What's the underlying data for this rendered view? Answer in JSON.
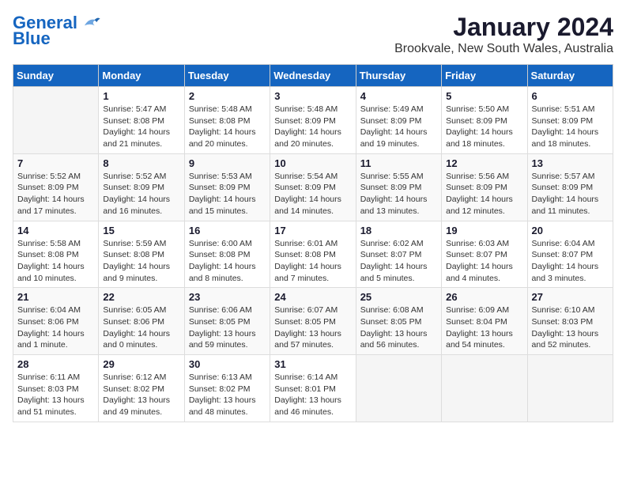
{
  "logo": {
    "line1": "General",
    "line2": "Blue"
  },
  "title": "January 2024",
  "subtitle": "Brookvale, New South Wales, Australia",
  "days_of_week": [
    "Sunday",
    "Monday",
    "Tuesday",
    "Wednesday",
    "Thursday",
    "Friday",
    "Saturday"
  ],
  "weeks": [
    [
      {
        "day": "",
        "info": ""
      },
      {
        "day": "1",
        "info": "Sunrise: 5:47 AM\nSunset: 8:08 PM\nDaylight: 14 hours\nand 21 minutes."
      },
      {
        "day": "2",
        "info": "Sunrise: 5:48 AM\nSunset: 8:08 PM\nDaylight: 14 hours\nand 20 minutes."
      },
      {
        "day": "3",
        "info": "Sunrise: 5:48 AM\nSunset: 8:09 PM\nDaylight: 14 hours\nand 20 minutes."
      },
      {
        "day": "4",
        "info": "Sunrise: 5:49 AM\nSunset: 8:09 PM\nDaylight: 14 hours\nand 19 minutes."
      },
      {
        "day": "5",
        "info": "Sunrise: 5:50 AM\nSunset: 8:09 PM\nDaylight: 14 hours\nand 18 minutes."
      },
      {
        "day": "6",
        "info": "Sunrise: 5:51 AM\nSunset: 8:09 PM\nDaylight: 14 hours\nand 18 minutes."
      }
    ],
    [
      {
        "day": "7",
        "info": "Sunrise: 5:52 AM\nSunset: 8:09 PM\nDaylight: 14 hours\nand 17 minutes."
      },
      {
        "day": "8",
        "info": "Sunrise: 5:52 AM\nSunset: 8:09 PM\nDaylight: 14 hours\nand 16 minutes."
      },
      {
        "day": "9",
        "info": "Sunrise: 5:53 AM\nSunset: 8:09 PM\nDaylight: 14 hours\nand 15 minutes."
      },
      {
        "day": "10",
        "info": "Sunrise: 5:54 AM\nSunset: 8:09 PM\nDaylight: 14 hours\nand 14 minutes."
      },
      {
        "day": "11",
        "info": "Sunrise: 5:55 AM\nSunset: 8:09 PM\nDaylight: 14 hours\nand 13 minutes."
      },
      {
        "day": "12",
        "info": "Sunrise: 5:56 AM\nSunset: 8:09 PM\nDaylight: 14 hours\nand 12 minutes."
      },
      {
        "day": "13",
        "info": "Sunrise: 5:57 AM\nSunset: 8:09 PM\nDaylight: 14 hours\nand 11 minutes."
      }
    ],
    [
      {
        "day": "14",
        "info": "Sunrise: 5:58 AM\nSunset: 8:08 PM\nDaylight: 14 hours\nand 10 minutes."
      },
      {
        "day": "15",
        "info": "Sunrise: 5:59 AM\nSunset: 8:08 PM\nDaylight: 14 hours\nand 9 minutes."
      },
      {
        "day": "16",
        "info": "Sunrise: 6:00 AM\nSunset: 8:08 PM\nDaylight: 14 hours\nand 8 minutes."
      },
      {
        "day": "17",
        "info": "Sunrise: 6:01 AM\nSunset: 8:08 PM\nDaylight: 14 hours\nand 7 minutes."
      },
      {
        "day": "18",
        "info": "Sunrise: 6:02 AM\nSunset: 8:07 PM\nDaylight: 14 hours\nand 5 minutes."
      },
      {
        "day": "19",
        "info": "Sunrise: 6:03 AM\nSunset: 8:07 PM\nDaylight: 14 hours\nand 4 minutes."
      },
      {
        "day": "20",
        "info": "Sunrise: 6:04 AM\nSunset: 8:07 PM\nDaylight: 14 hours\nand 3 minutes."
      }
    ],
    [
      {
        "day": "21",
        "info": "Sunrise: 6:04 AM\nSunset: 8:06 PM\nDaylight: 14 hours\nand 1 minute."
      },
      {
        "day": "22",
        "info": "Sunrise: 6:05 AM\nSunset: 8:06 PM\nDaylight: 14 hours\nand 0 minutes."
      },
      {
        "day": "23",
        "info": "Sunrise: 6:06 AM\nSunset: 8:05 PM\nDaylight: 13 hours\nand 59 minutes."
      },
      {
        "day": "24",
        "info": "Sunrise: 6:07 AM\nSunset: 8:05 PM\nDaylight: 13 hours\nand 57 minutes."
      },
      {
        "day": "25",
        "info": "Sunrise: 6:08 AM\nSunset: 8:05 PM\nDaylight: 13 hours\nand 56 minutes."
      },
      {
        "day": "26",
        "info": "Sunrise: 6:09 AM\nSunset: 8:04 PM\nDaylight: 13 hours\nand 54 minutes."
      },
      {
        "day": "27",
        "info": "Sunrise: 6:10 AM\nSunset: 8:03 PM\nDaylight: 13 hours\nand 52 minutes."
      }
    ],
    [
      {
        "day": "28",
        "info": "Sunrise: 6:11 AM\nSunset: 8:03 PM\nDaylight: 13 hours\nand 51 minutes."
      },
      {
        "day": "29",
        "info": "Sunrise: 6:12 AM\nSunset: 8:02 PM\nDaylight: 13 hours\nand 49 minutes."
      },
      {
        "day": "30",
        "info": "Sunrise: 6:13 AM\nSunset: 8:02 PM\nDaylight: 13 hours\nand 48 minutes."
      },
      {
        "day": "31",
        "info": "Sunrise: 6:14 AM\nSunset: 8:01 PM\nDaylight: 13 hours\nand 46 minutes."
      },
      {
        "day": "",
        "info": ""
      },
      {
        "day": "",
        "info": ""
      },
      {
        "day": "",
        "info": ""
      }
    ]
  ]
}
